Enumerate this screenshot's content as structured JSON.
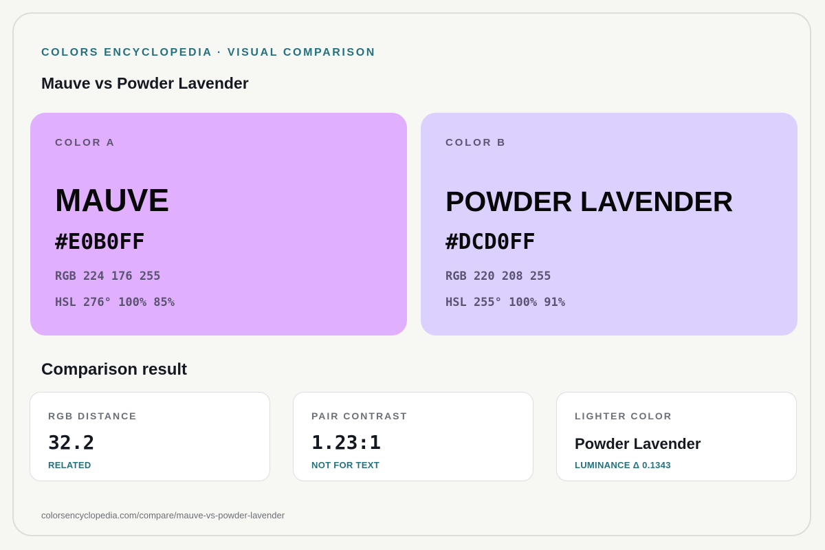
{
  "header": {
    "kicker": "COLORS ENCYCLOPEDIA · VISUAL COMPARISON",
    "title": "Mauve vs Powder Lavender"
  },
  "colors": {
    "a": {
      "label": "COLOR A",
      "name": "MAUVE",
      "hex": "#E0B0FF",
      "rgb": "RGB 224 176 255",
      "hsl": "HSL 276° 100% 85%",
      "swatch_color": "#E0B0FF"
    },
    "b": {
      "label": "COLOR B",
      "name": "POWDER LAVENDER",
      "hex": "#DCD0FF",
      "rgb": "RGB 220 208 255",
      "hsl": "HSL 255° 100% 91%",
      "swatch_color": "#DCD0FF"
    }
  },
  "comparison": {
    "title": "Comparison result",
    "metrics": [
      {
        "label": "RGB DISTANCE",
        "value": "32.2",
        "note": "RELATED"
      },
      {
        "label": "PAIR CONTRAST",
        "value": "1.23:1",
        "note": "NOT FOR TEXT"
      },
      {
        "label": "LIGHTER COLOR",
        "value": "Powder Lavender",
        "note": "LUMINANCE Δ 0.1343"
      }
    ]
  },
  "footer": {
    "url": "colorsencyclopedia.com/compare/mauve-vs-powder-lavender"
  },
  "theme": {
    "accent": "#23727e",
    "text": "#141820"
  }
}
